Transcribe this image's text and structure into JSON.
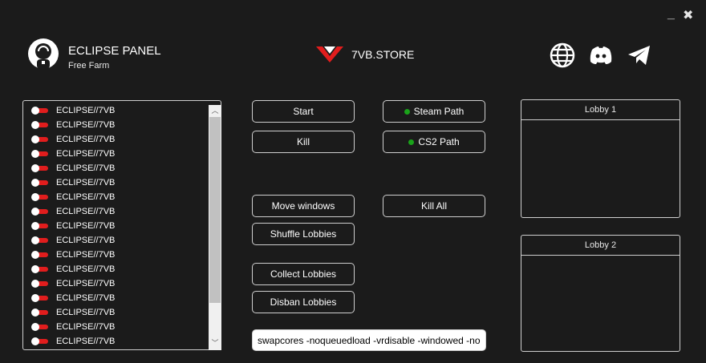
{
  "window": {
    "minimize_glyph": "_",
    "close_glyph": "✖"
  },
  "brand": {
    "title": "ECLIPSE PANEL",
    "subtitle": "Free Farm",
    "logo_icon": "astronaut-icon"
  },
  "store": {
    "name": "7VB.STORE",
    "logo_icon": "v-logo-icon",
    "logo_color": "#e11d1d"
  },
  "social": [
    {
      "name": "globe-icon"
    },
    {
      "name": "discord-icon"
    },
    {
      "name": "telegram-icon"
    }
  ],
  "accounts": {
    "items": [
      "ECLIPSE//7VB",
      "ECLIPSE//7VB",
      "ECLIPSE//7VB",
      "ECLIPSE//7VB",
      "ECLIPSE//7VB",
      "ECLIPSE//7VB",
      "ECLIPSE//7VB",
      "ECLIPSE//7VB",
      "ECLIPSE//7VB",
      "ECLIPSE//7VB",
      "ECLIPSE//7VB",
      "ECLIPSE//7VB",
      "ECLIPSE//7VB",
      "ECLIPSE//7VB",
      "ECLIPSE//7VB",
      "ECLIPSE//7VB",
      "ECLIPSE//7VB"
    ],
    "toggle_color": "#e11d1d"
  },
  "buttons": {
    "start": "Start",
    "kill": "Kill",
    "steam_path": "Steam Path",
    "cs2_path": "CS2 Path",
    "move_windows": "Move windows",
    "kill_all": "Kill All",
    "shuffle_lobbies": "Shuffle Lobbies",
    "collect_lobbies": "Collect Lobbies",
    "disban_lobbies": "Disban Lobbies"
  },
  "status_color": "#1aa31a",
  "launch_args": {
    "value": "swapcores -noqueuedload -vrdisable -windowed -nohltv"
  },
  "lobbies": {
    "lobby1": "Lobby 1",
    "lobby2": "Lobby 2"
  }
}
